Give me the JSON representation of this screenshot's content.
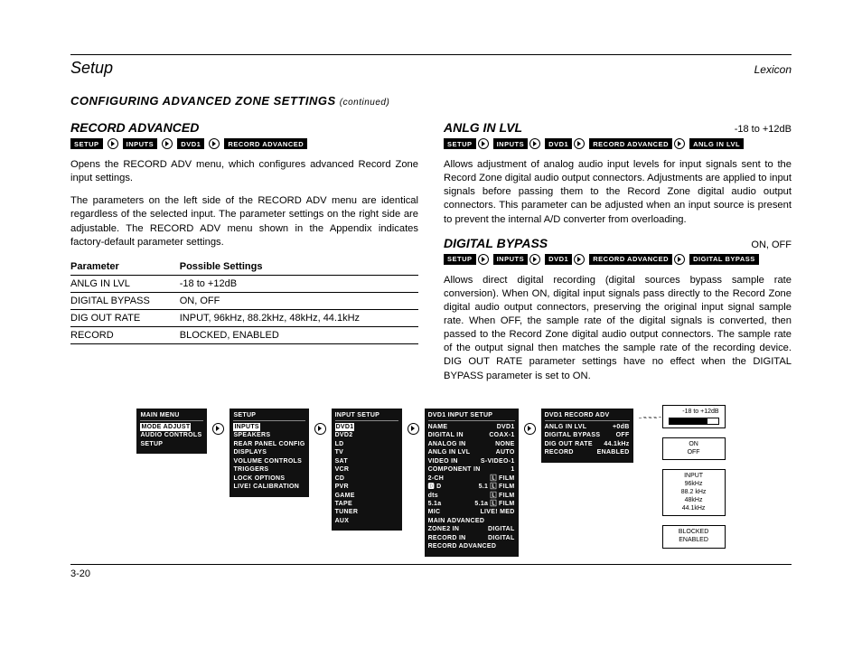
{
  "header": {
    "left": "Setup",
    "right": "Lexicon"
  },
  "section": {
    "title": "CONFIGURING ADVANCED ZONE SETTINGS",
    "continued": "(continued)"
  },
  "left": {
    "title": "RECORD ADVANCED",
    "crumbs": [
      "SETUP",
      "INPUTS",
      "DVD1",
      "RECORD ADVANCED"
    ],
    "p1": "Opens the RECORD ADV menu, which configures advanced Record Zone input settings.",
    "p2": "The parameters on the left side of the RECORD ADV menu are identical regardless of the selected input. The parameter settings on the right side are adjustable. The RECORD ADV menu shown in the Appendix indicates factory-default parameter settings.",
    "table": {
      "h1": "Parameter",
      "h2": "Possible Settings",
      "rows": [
        {
          "p": "ANLG IN LVL",
          "s": "-18 to +12dB"
        },
        {
          "p": "DIGITAL BYPASS",
          "s": "ON, OFF"
        },
        {
          "p": "DIG OUT RATE",
          "s": "INPUT, 96kHz, 88.2kHz, 48kHz, 44.1kHz"
        },
        {
          "p": "RECORD",
          "s": "BLOCKED, ENABLED"
        }
      ]
    }
  },
  "right": {
    "a": {
      "title": "ANLG IN LVL",
      "range": "-18 to +12dB",
      "crumbs": [
        "SETUP",
        "INPUTS",
        "DVD1",
        "RECORD ADVANCED",
        "ANLG IN LVL"
      ],
      "p": "Allows adjustment of analog audio input levels for input signals sent to the Record Zone digital audio output connectors. Adjustments are applied to input signals before passing them to the Record Zone digital audio output connectors. This parameter can be adjusted when an input source is present to prevent the internal A/D converter from overloading."
    },
    "b": {
      "title": "DIGITAL BYPASS",
      "range": "ON, OFF",
      "crumbs": [
        "SETUP",
        "INPUTS",
        "DVD1",
        "RECORD ADVANCED",
        "DIGITAL BYPASS"
      ],
      "p": "Allows direct digital recording (digital sources bypass sample rate conversion). When ON, digital input signals pass directly to the Record Zone digital audio output connectors, preserving the original input signal sample rate. When OFF, the sample rate of the digital signals is converted, then passed to the Record Zone digital audio output connectors. The sample rate of the output signal then matches the sample rate of the recording device. DIG OUT RATE parameter settings have no effect when the DIGITAL BYPASS parameter is set to ON."
    }
  },
  "menus": {
    "m0": {
      "title": "MAIN MENU",
      "sel": "MODE ADJUST",
      "rest": "AUDIO CONTROLS\nSETUP"
    },
    "m1": {
      "title": "SETUP",
      "sel": "INPUTS",
      "rest": "SPEAKERS\nREAR PANEL CONFIG\nDISPLAYS\nVOLUME CONTROLS\nTRIGGERS\nLOCK OPTIONS\nLIVE! CALIBRATION"
    },
    "m2": {
      "title": "INPUT SETUP",
      "sel": "DVD1",
      "rest": "DVD2\nLD\nTV\nSAT\nVCR\nCD\nPVR\nGAME\nTAPE\nTUNER\nAUX"
    },
    "m3": {
      "title": "DVD1 INPUT SETUP",
      "rows": [
        [
          "NAME",
          "DVD1"
        ],
        [
          "DIGITAL IN",
          "COAX-1"
        ],
        [
          "ANALOG IN",
          "NONE"
        ],
        [
          "ANLG IN LVL",
          "AUTO"
        ],
        [
          "VIDEO IN",
          "S-VIDEO-1"
        ],
        [
          "COMPONENT IN",
          "1"
        ],
        [
          "2-CH",
          "🄻 FILM"
        ],
        [
          "🅳 D",
          "5.1 🄻 FILM"
        ],
        [
          "dts",
          "🄻 FILM"
        ],
        [
          "5.1a",
          "5.1a 🄻 FILM"
        ],
        [
          "MIC",
          "LIVE! MED"
        ],
        [
          "MAIN ADVANCED",
          ""
        ],
        [
          "ZONE2 IN",
          "DIGITAL"
        ],
        [
          "RECORD IN",
          "DIGITAL"
        ],
        [
          "RECORD ADVANCED",
          ""
        ]
      ]
    },
    "m4": {
      "title": "DVD1 RECORD ADV",
      "rows": [
        [
          "ANLG IN LVL",
          "+0dB"
        ],
        [
          "DIGITAL BYPASS",
          "OFF"
        ],
        [
          "DIG OUT RATE",
          "44.1kHz"
        ],
        [
          "RECORD",
          "ENABLED"
        ]
      ]
    },
    "vals": {
      "v1_label": "-18 to +12dB",
      "v2": "ON\nOFF",
      "v3": "INPUT\n96kHz\n88.2 kHz\n48kHz\n44.1kHz",
      "v4": "BLOCKED\nENABLED"
    }
  },
  "footer": "3-20"
}
